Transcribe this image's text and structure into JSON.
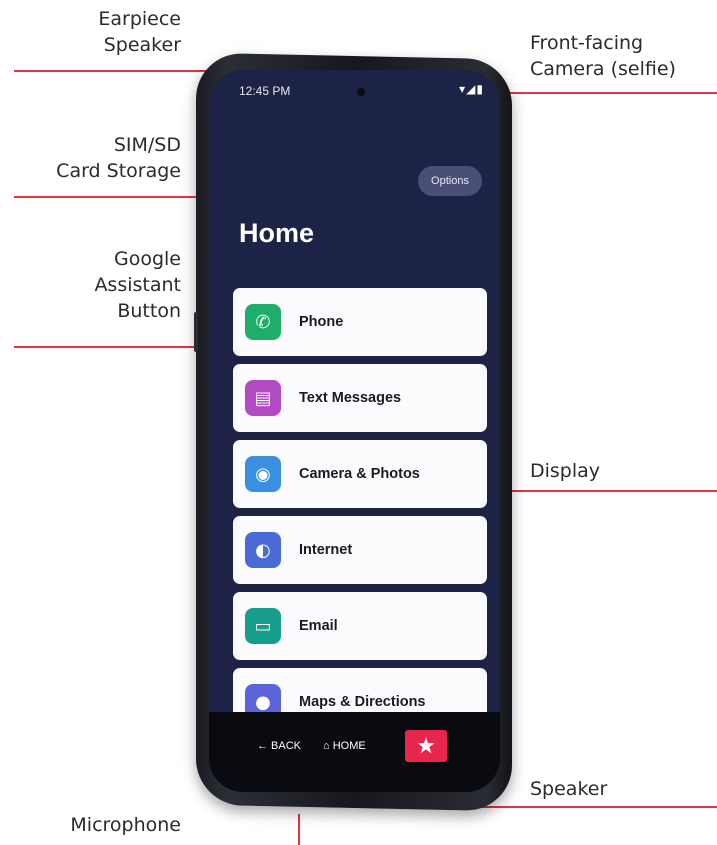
{
  "callouts": {
    "earpiece": [
      "Earpiece",
      "Speaker"
    ],
    "front_camera": [
      "Front-facing",
      "Camera (selfie)"
    ],
    "sim_sd": [
      "SIM/SD",
      "Card Storage"
    ],
    "google_assistant": [
      "Google",
      "Assistant",
      "Button"
    ],
    "display": "Display",
    "speaker": "Speaker",
    "microphone": "Microphone"
  },
  "screen": {
    "time": "12:45 PM",
    "status_icons": "▾◢▮",
    "options_label": "Options",
    "title": "Home",
    "apps": [
      {
        "label": "Phone",
        "icon": "phone-icon",
        "color": "#1fae6a",
        "glyph": "✆"
      },
      {
        "label": "Text Messages",
        "icon": "text-message-icon",
        "color": "#b24ac4",
        "glyph": "▤"
      },
      {
        "label": "Camera & Photos",
        "icon": "camera-icon",
        "color": "#3a8fe0",
        "glyph": "◉"
      },
      {
        "label": "Internet",
        "icon": "globe-icon",
        "color": "#4a6bd6",
        "glyph": "◐"
      },
      {
        "label": "Email",
        "icon": "email-icon",
        "color": "#169e8a",
        "glyph": "▭"
      },
      {
        "label": "Maps & Directions",
        "icon": "map-pin-icon",
        "color": "#5b63d8",
        "glyph": "●"
      }
    ],
    "nav": {
      "back_label": "← BACK",
      "home_label": "⌂ HOME",
      "star_glyph": "★"
    }
  },
  "colors": {
    "leader_line": "#e5333f",
    "screen_bg": "#1d2346",
    "star_button": "#e8264b"
  }
}
